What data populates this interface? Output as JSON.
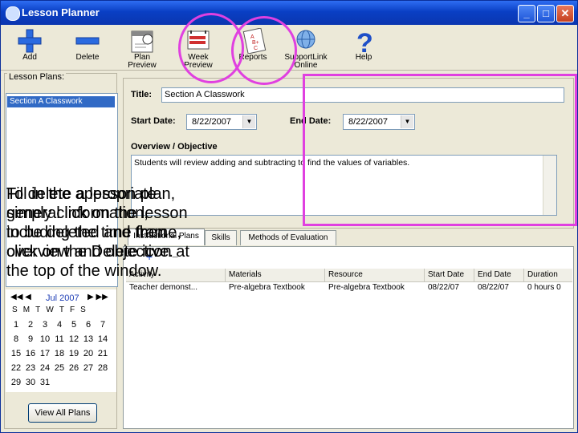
{
  "window": {
    "title": "Lesson Planner",
    "controls": {
      "minimize": "_",
      "maximize": "□",
      "close": "✕"
    }
  },
  "toolbar": [
    {
      "label": "Add",
      "icon": "plus-icon"
    },
    {
      "label": "Delete",
      "icon": "minus-icon"
    },
    {
      "label": "Plan\nPreview",
      "icon": "calendar-page-icon"
    },
    {
      "label": "Week\nPreview",
      "icon": "week-calendar-icon"
    },
    {
      "label": "Reports",
      "icon": "report-grades-icon"
    },
    {
      "label": "SupportLink\nOnline",
      "icon": "globe-icon"
    },
    {
      "label": "Help",
      "icon": "question-mark-icon"
    }
  ],
  "left": {
    "plans_label": "Lesson Plans:",
    "plans": [
      "Section A Classwork"
    ],
    "calendar": {
      "month": "Jul 2007",
      "nav_prev": "◀◀ ◀",
      "nav_next": "▶ ▶▶",
      "weekdays": [
        "S",
        "M",
        "T",
        "W",
        "T",
        "F",
        "S"
      ],
      "rows": [
        [
          "1",
          "2",
          "3",
          "4",
          "5",
          "6",
          "7"
        ],
        [
          "8",
          "9",
          "10",
          "11",
          "12",
          "13",
          "14"
        ],
        [
          "15",
          "16",
          "17",
          "18",
          "19",
          "20",
          "21"
        ],
        [
          "22",
          "23",
          "24",
          "25",
          "26",
          "27",
          "28"
        ],
        [
          "29",
          "30",
          "31",
          "",
          "",
          "",
          ""
        ]
      ]
    },
    "view_all_label": "View All Plans"
  },
  "form": {
    "title_label": "Title:",
    "title_value": "Section A Classwork",
    "start_label": "Start Date:",
    "start_value": "8/22/2007",
    "end_label": "End Date:",
    "end_value": "8/22/2007",
    "overview_label": "Overview / Objective",
    "overview_value": "Students will review adding and subtracting to find the values of variables."
  },
  "tabs": [
    "Instructional Plans",
    "Skills",
    "Methods of Evaluation"
  ],
  "grid": {
    "toolbar": {
      "add": "+",
      "remove": "−"
    },
    "columns": [
      "Activity",
      "Materials",
      "Resource",
      "Start Date",
      "End Date",
      "Duration"
    ],
    "rows": [
      [
        "Teacher demonst...",
        "Pre-algebra Textbook",
        "Pre-algebra Textbook",
        "08/22/07",
        "08/22/07",
        "0 hours 0"
      ]
    ]
  },
  "overlay_text_1": "To delete a lesson plan, simply click on the lesson to be deleted and then click on the Delete icon at the top of the window.",
  "overlay_text_2": "Fill in the appropriate general information, including the time frame, overview and objective."
}
